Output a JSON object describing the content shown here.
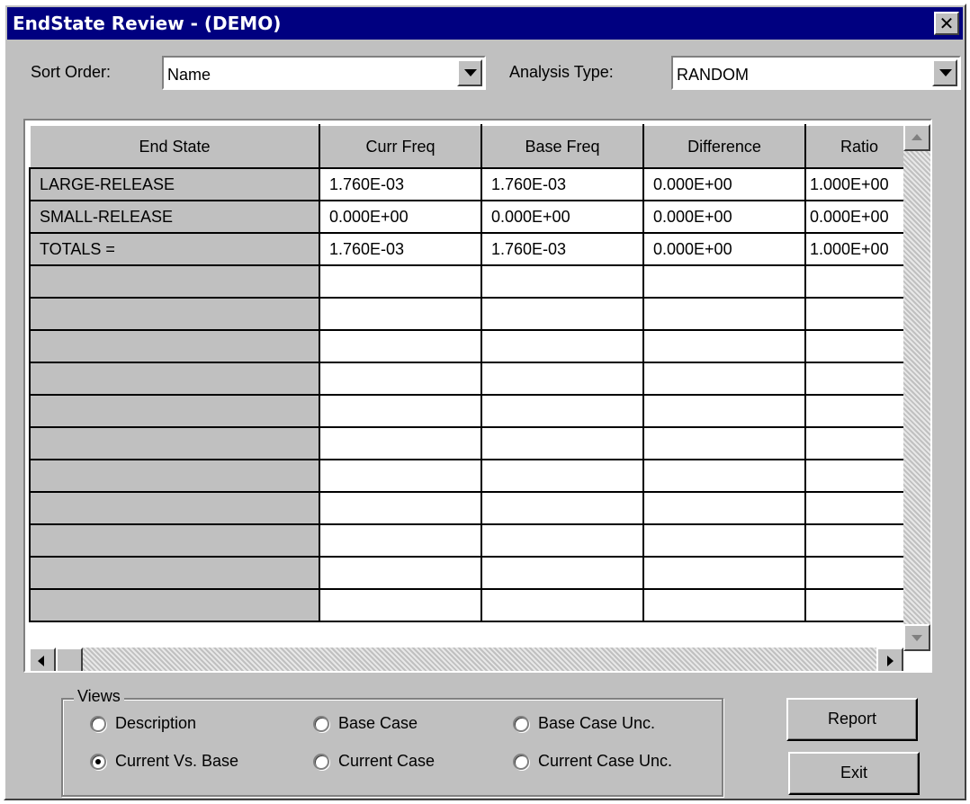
{
  "window": {
    "title": "EndState Review  -  (DEMO)",
    "close_glyph": "✕"
  },
  "sort": {
    "label": "Sort Order:",
    "value": "Name"
  },
  "analysis": {
    "label": "Analysis Type:",
    "value": "RANDOM"
  },
  "table": {
    "columns": [
      "End State",
      "Curr Freq",
      "Base Freq",
      "Difference",
      "Ratio"
    ],
    "rows": [
      [
        "LARGE-RELEASE",
        "1.760E-03",
        "1.760E-03",
        "0.000E+00",
        "1.000E+00"
      ],
      [
        "SMALL-RELEASE",
        "0.000E+00",
        "0.000E+00",
        "0.000E+00",
        "0.000E+00"
      ],
      [
        "TOTALS =",
        "1.760E-03",
        "1.760E-03",
        "0.000E+00",
        "1.000E+00"
      ]
    ]
  },
  "views": {
    "label": "Views",
    "options": [
      {
        "label": "Description",
        "selected": false
      },
      {
        "label": "Base Case",
        "selected": false
      },
      {
        "label": "Base Case Unc.",
        "selected": false
      },
      {
        "label": "Current Vs. Base",
        "selected": true
      },
      {
        "label": "Current Case",
        "selected": false
      },
      {
        "label": "Current Case Unc.",
        "selected": false
      }
    ]
  },
  "buttons": {
    "report": "Report",
    "exit": "Exit"
  }
}
